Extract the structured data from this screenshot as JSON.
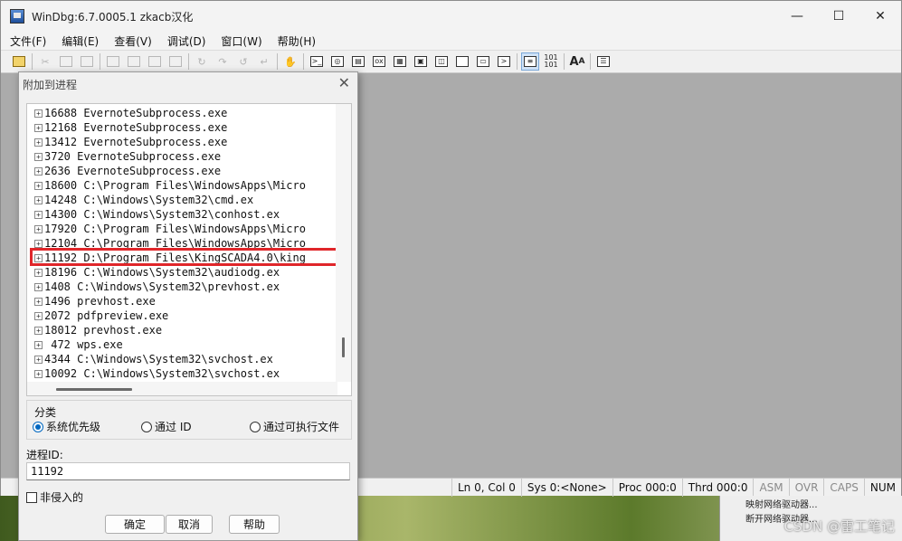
{
  "window": {
    "title": "WinDbg:6.7.0005.1 zkacb汉化",
    "controls": {
      "minimize": "—",
      "maximize": "☐",
      "close": "✕"
    }
  },
  "menu": {
    "items": [
      "文件(F)",
      "编辑(E)",
      "查看(V)",
      "调试(D)",
      "窗口(W)",
      "帮助(H)"
    ]
  },
  "toolbar": {
    "icons": [
      "open-icon",
      "cut-icon",
      "copy-icon",
      "paste-icon",
      "go-icon",
      "restart-icon",
      "stop-icon",
      "break-icon",
      "step-into-icon",
      "step-over-icon",
      "step-out-icon",
      "run-to-cursor-icon",
      "hand-icon",
      "command-icon",
      "watch-icon",
      "locals-icon",
      "registers-icon",
      "memory-icon",
      "call-stack-icon",
      "disassembly-icon",
      "scratch-pad-icon",
      "source-mode-icon",
      "hex-mode-icon",
      "font-icon",
      "options-icon"
    ]
  },
  "dialog": {
    "title": "附加到进程",
    "close": "✕",
    "processes": [
      "16688 EvernoteSubprocess.exe",
      "12168 EvernoteSubprocess.exe",
      "13412 EvernoteSubprocess.exe",
      "3720 EvernoteSubprocess.exe",
      "2636 EvernoteSubprocess.exe",
      "18600 C:\\Program Files\\WindowsApps\\Micro",
      "14248 C:\\Windows\\System32\\cmd.ex",
      "14300 C:\\Windows\\System32\\conhost.ex",
      "17920 C:\\Program Files\\WindowsApps\\Micro",
      "12104 C:\\Program Files\\WindowsApps\\Micro",
      "11192 D:\\Program Files\\KingSCADA4.0\\king",
      "18196 C:\\Windows\\System32\\audiodg.ex",
      "1408 C:\\Windows\\System32\\prevhost.ex",
      "1496 prevhost.exe",
      "2072 pdfpreview.exe",
      "18012 prevhost.exe",
      " 472 wps.exe",
      "4344 C:\\Windows\\System32\\svchost.ex",
      "10092 C:\\Windows\\System32\\svchost.ex"
    ],
    "expander": "+",
    "selected_index": 10,
    "highlight_color": "#e0262a",
    "group_label": "分类",
    "radio_options": [
      "系统优先级",
      "通过 ID",
      "通过可执行文件"
    ],
    "radio_selected": 0,
    "pid_label": "进程ID:",
    "pid_value": "11192",
    "noninvasive_label": "非侵入的",
    "buttons": {
      "ok": "确定",
      "cancel": "取消",
      "help": "帮助"
    }
  },
  "statusbar": {
    "cells": [
      "Ln 0, Col 0",
      "Sys 0:<None>",
      "Proc 000:0",
      "Thrd 000:0",
      "ASM",
      "OVR",
      "CAPS",
      "NUM"
    ]
  },
  "background": {
    "lines": [
      "映射网络驱动器...",
      "断开网络驱动器..."
    ],
    "watermark": "CSDN @雷工笔记"
  }
}
